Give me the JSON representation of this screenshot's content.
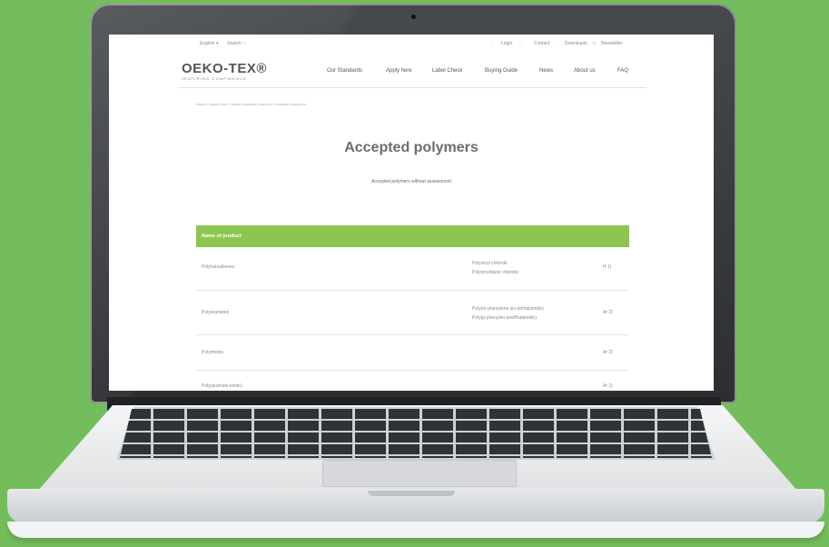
{
  "site": {
    "lang_label": "English",
    "search_label": "Search",
    "top_links": [
      "Login",
      "Contact",
      "Downloads",
      "Newsletter"
    ],
    "logo_text": "OEKO-TEX®",
    "logo_tagline": "INSPIRING CONFIDENCE",
    "nav": [
      "Our Standards",
      "Apply here",
      "Label Check",
      "Buying Guide",
      "News",
      "About us",
      "FAQ"
    ],
    "breadcrumb": "Home > Apply here > Active chemical products > Accepted polymers",
    "title": "Accepted polymers",
    "subtitle": "Accepted polymers without assessment"
  },
  "table": {
    "header": "Name of product",
    "rows": [
      {
        "name": "Polyhaloalkenes",
        "items": [
          "Polyvinyl chloride",
          "Polyvinylidene chloride"
        ],
        "ref": "H 1)"
      },
      {
        "name": "Polyaramides",
        "items": [
          "Poly(m-phenylene iso-phthalamide)",
          "Poly(p-phenylen terefthalamide)"
        ],
        "ref": "Ar 2)"
      },
      {
        "name": "Polyimides",
        "items": [],
        "ref": "Ar 2)"
      },
      {
        "name": "Poly(aramide-imide)",
        "items": [],
        "ref": "Ar 2)"
      }
    ]
  },
  "colors": {
    "background": "#74bd5c",
    "accent": "#8dc64f"
  }
}
